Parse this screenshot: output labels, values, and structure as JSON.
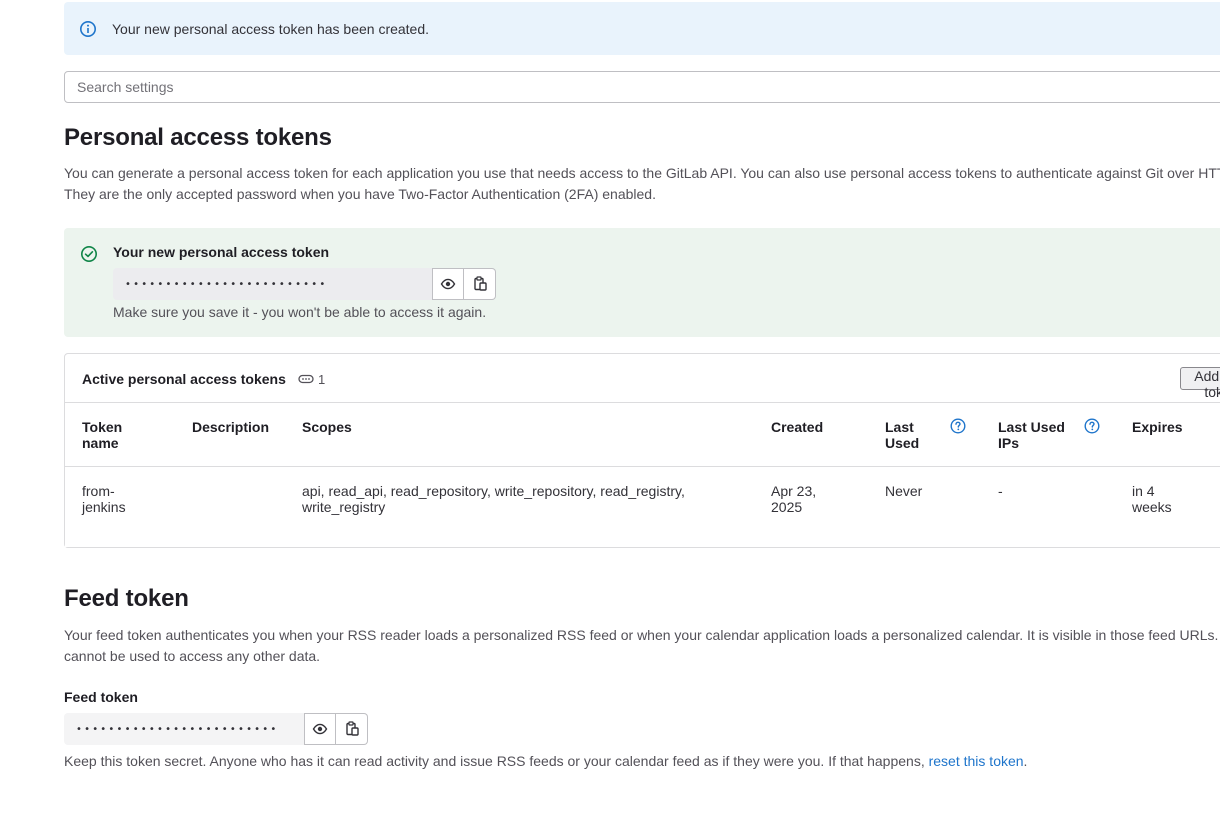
{
  "alert": {
    "message": "Your new personal access token has been created."
  },
  "search": {
    "placeholder": "Search settings"
  },
  "pat": {
    "title": "Personal access tokens",
    "description_1": "You can generate a personal access token for each application you use that needs access to the GitLab API. You can also use personal access tokens to authenticate against Git over HTTP.",
    "description_2": "They are the only accepted password when you have Two-Factor Authentication (2FA) enabled.",
    "new_token": {
      "title": "Your new personal access token",
      "masked_value": "•••••••••••••••••••••••••",
      "note": "Make sure you save it - you won't be able to access it again."
    }
  },
  "active_tokens": {
    "title": "Active personal access tokens",
    "count": "1",
    "add_button": "Add new token",
    "columns": {
      "token_name": "Token name",
      "description": "Description",
      "scopes": "Scopes",
      "created": "Created",
      "last_used": "Last Used",
      "last_used_ips": "Last Used IPs",
      "expires": "Expires"
    },
    "rows": [
      {
        "token_name": "from-jenkins",
        "description": "",
        "scopes": "api, read_api, read_repository, write_repository, read_registry, write_registry",
        "created": "Apr 23, 2025",
        "last_used": "Never",
        "last_used_ips": "-",
        "expires": "in 4 weeks"
      }
    ]
  },
  "feed": {
    "title": "Feed token",
    "description_1": "Your feed token authenticates you when your RSS reader loads a personalized RSS feed or when your calendar application loads a personalized calendar. It is visible in those feed URLs.",
    "description_2": "cannot be used to access any other data.",
    "label": "Feed token",
    "masked_value": "•••••••••••••••••••••••••",
    "note_prefix": "Keep this token secret. Anyone who has it can read activity and issue RSS feeds or your calendar feed as if they were you. If that happens, ",
    "reset_link": "reset this token",
    "note_suffix": "."
  },
  "colors": {
    "info_bg": "#e9f3fc",
    "success_bg": "#ecf4ee",
    "link": "#1f75cb",
    "success_icon": "#108548",
    "info_icon": "#1f75cb"
  }
}
